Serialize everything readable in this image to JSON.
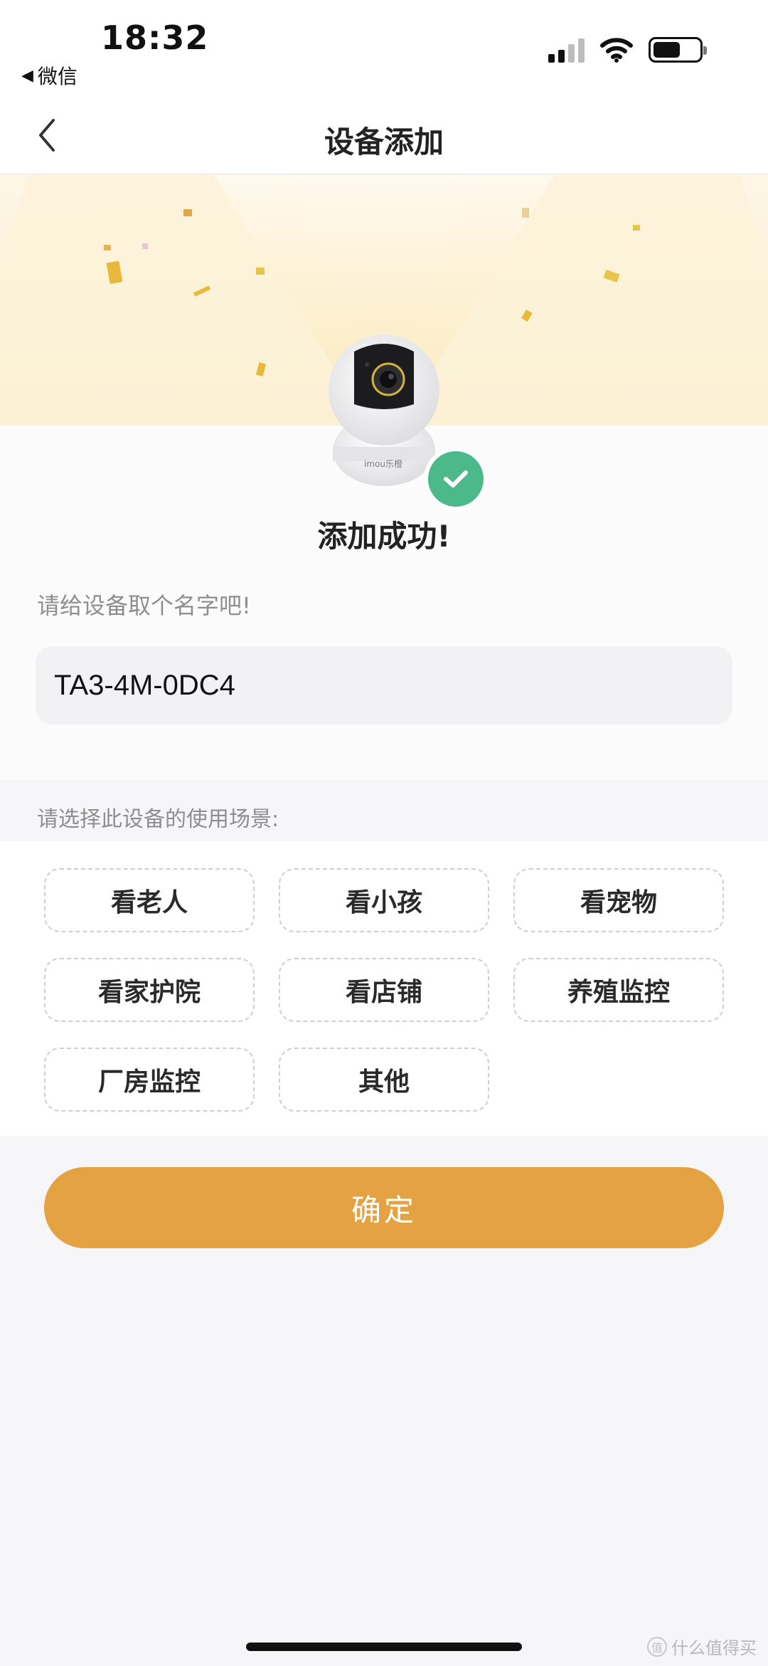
{
  "status_bar": {
    "time": "18:32",
    "back_app_label": "微信",
    "back_app_arrow": "◀"
  },
  "nav": {
    "title": "设备添加"
  },
  "success": {
    "message": "添加成功!",
    "camera_brand": "imou乐橙"
  },
  "name_form": {
    "prompt": "请给设备取个名字吧!",
    "value": "TA3-4M-0DC4"
  },
  "scene": {
    "prompt": "请选择此设备的使用场景:",
    "options": [
      "看老人",
      "看小孩",
      "看宠物",
      "看家护院",
      "看店铺",
      "养殖监控",
      "厂房监控",
      "其他"
    ]
  },
  "confirm_button": "确定",
  "watermark": "什么值得买",
  "colors": {
    "accent": "#e4a242",
    "success": "#4cb98b"
  }
}
